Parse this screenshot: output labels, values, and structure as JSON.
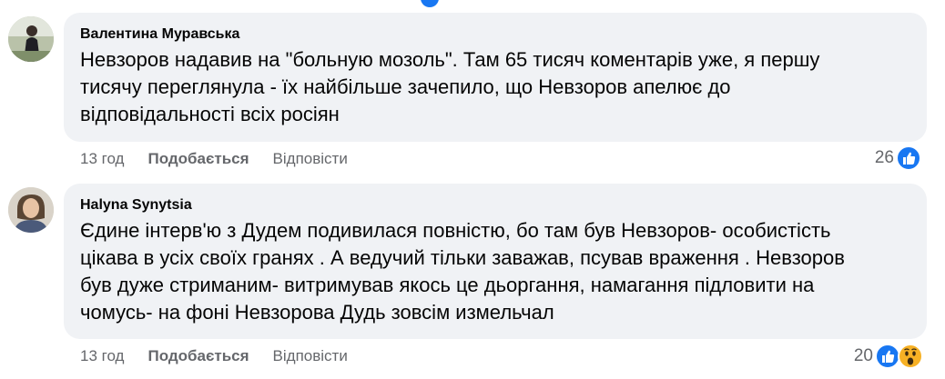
{
  "comments": [
    {
      "author": "Валентина Муравська",
      "lines": [
        "Невзоров надавив на \"больную мозоль\". Там 65 тисяч коментарів уже, я першу",
        "тисячу переглянула - їх найбільше зачепило, що Невзоров апелює до",
        "відповідальності всіх росіян"
      ],
      "time": "13 год",
      "like_label": "Подобається",
      "reply_label": "Відповісти",
      "reaction_count": "26",
      "reactions": [
        "like-icon"
      ]
    },
    {
      "author": "Halyna Synytsia",
      "lines": [
        "Єдине інтерв'ю з Дудем подивилася повністю, бо там був Невзоров- особистість",
        "цікава в усіх своїх гранях . А ведучий тільки заважав, псував враження . Невзоров",
        "був дуже стриманим- витримував якось це дьоргання, намагання підловити на",
        "чомусь- на фоні Невзорова Дудь зовсім измельчал"
      ],
      "time": "13 год",
      "like_label": "Подобається",
      "reply_label": "Відповісти",
      "reaction_count": "20",
      "reactions": [
        "like-icon",
        "wow-icon"
      ]
    }
  ],
  "colors": {
    "bubble": "#f0f2f5",
    "meta_text": "#65676b",
    "like_blue": "#1877f2",
    "wow_yellow": "#f7b125"
  }
}
